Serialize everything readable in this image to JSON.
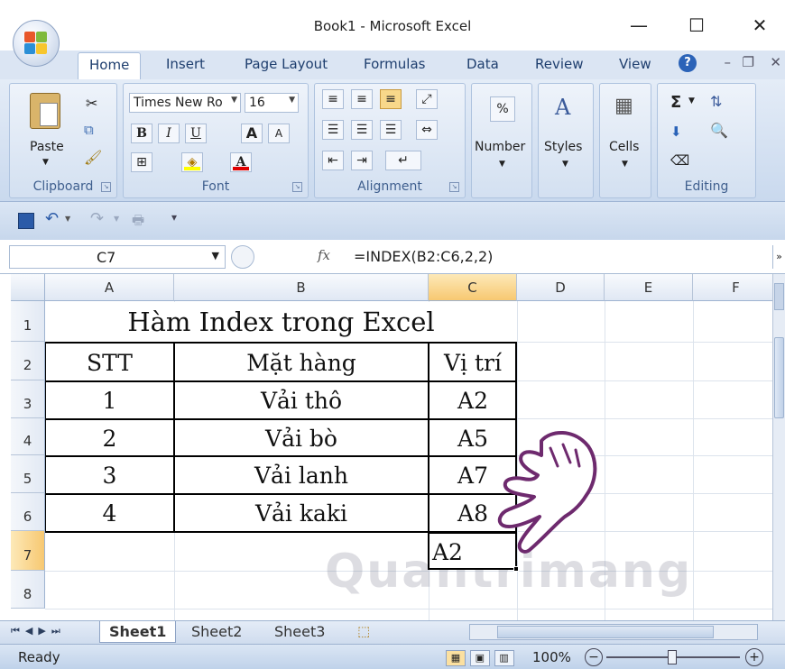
{
  "window": {
    "title": "Book1 - Microsoft Excel",
    "controls": [
      "—",
      "☐",
      "✕"
    ]
  },
  "tabs": [
    "Home",
    "Insert",
    "Page Layout",
    "Formulas",
    "Data",
    "Review",
    "View"
  ],
  "ribbon": {
    "clipboard": {
      "label": "Clipboard",
      "paste": "Paste"
    },
    "font": {
      "label": "Font",
      "name": "Times New Ro",
      "size": "16",
      "bold": "B",
      "italic": "I",
      "underline": "U",
      "grow": "A",
      "shrink": "A",
      "fill_color": "#FFFF00",
      "font_color": "#E00000"
    },
    "alignment": {
      "label": "Alignment"
    },
    "number": {
      "label": "Number",
      "symbol": "%"
    },
    "styles": {
      "label": "Styles"
    },
    "cells": {
      "label": "Cells"
    },
    "editing": {
      "label": "Editing",
      "sum": "Σ"
    }
  },
  "formula_bar": {
    "name_box": "C7",
    "fx": "fx",
    "formula": "=INDEX(B2:C6,2,2)"
  },
  "columns": [
    "A",
    "B",
    "C",
    "D",
    "E",
    "F"
  ],
  "rows": [
    "1",
    "2",
    "3",
    "4",
    "5",
    "6",
    "7",
    "8"
  ],
  "sheet": {
    "title": "Hàm Index trong Excel",
    "headers": {
      "stt": "STT",
      "item": "Mặt hàng",
      "pos": "Vị trí"
    },
    "data": [
      {
        "stt": "1",
        "item": "Vải thô",
        "pos": "A2"
      },
      {
        "stt": "2",
        "item": "Vải bò",
        "pos": "A5"
      },
      {
        "stt": "3",
        "item": "Vải lanh",
        "pos": "A7"
      },
      {
        "stt": "4",
        "item": "Vải kaki",
        "pos": "A8"
      }
    ],
    "c7": "A2"
  },
  "sheets": [
    "Sheet1",
    "Sheet2",
    "Sheet3"
  ],
  "status": {
    "mode": "Ready",
    "zoom": "100%"
  },
  "watermark": "Quantrimang"
}
